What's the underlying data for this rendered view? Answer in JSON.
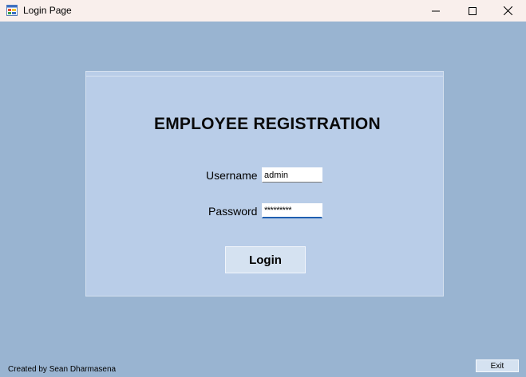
{
  "window": {
    "title": "Login Page",
    "controls": {
      "minimize_icon": "minimize-icon",
      "maximize_icon": "maximize-icon",
      "close_icon": "close-icon"
    }
  },
  "form": {
    "heading": "EMPLOYEE REGISTRATION",
    "username_label": "Username",
    "username_value": "admin",
    "password_label": "Password",
    "password_value": "*********",
    "login_label": "Login"
  },
  "footer": {
    "credit": "Created by Sean Dharmasena",
    "exit_label": "Exit"
  },
  "colors": {
    "background": "#99b4d1",
    "panel": "#b9cde8",
    "titlebar": "#f9efec",
    "focus_underline": "#1f5fb0"
  }
}
